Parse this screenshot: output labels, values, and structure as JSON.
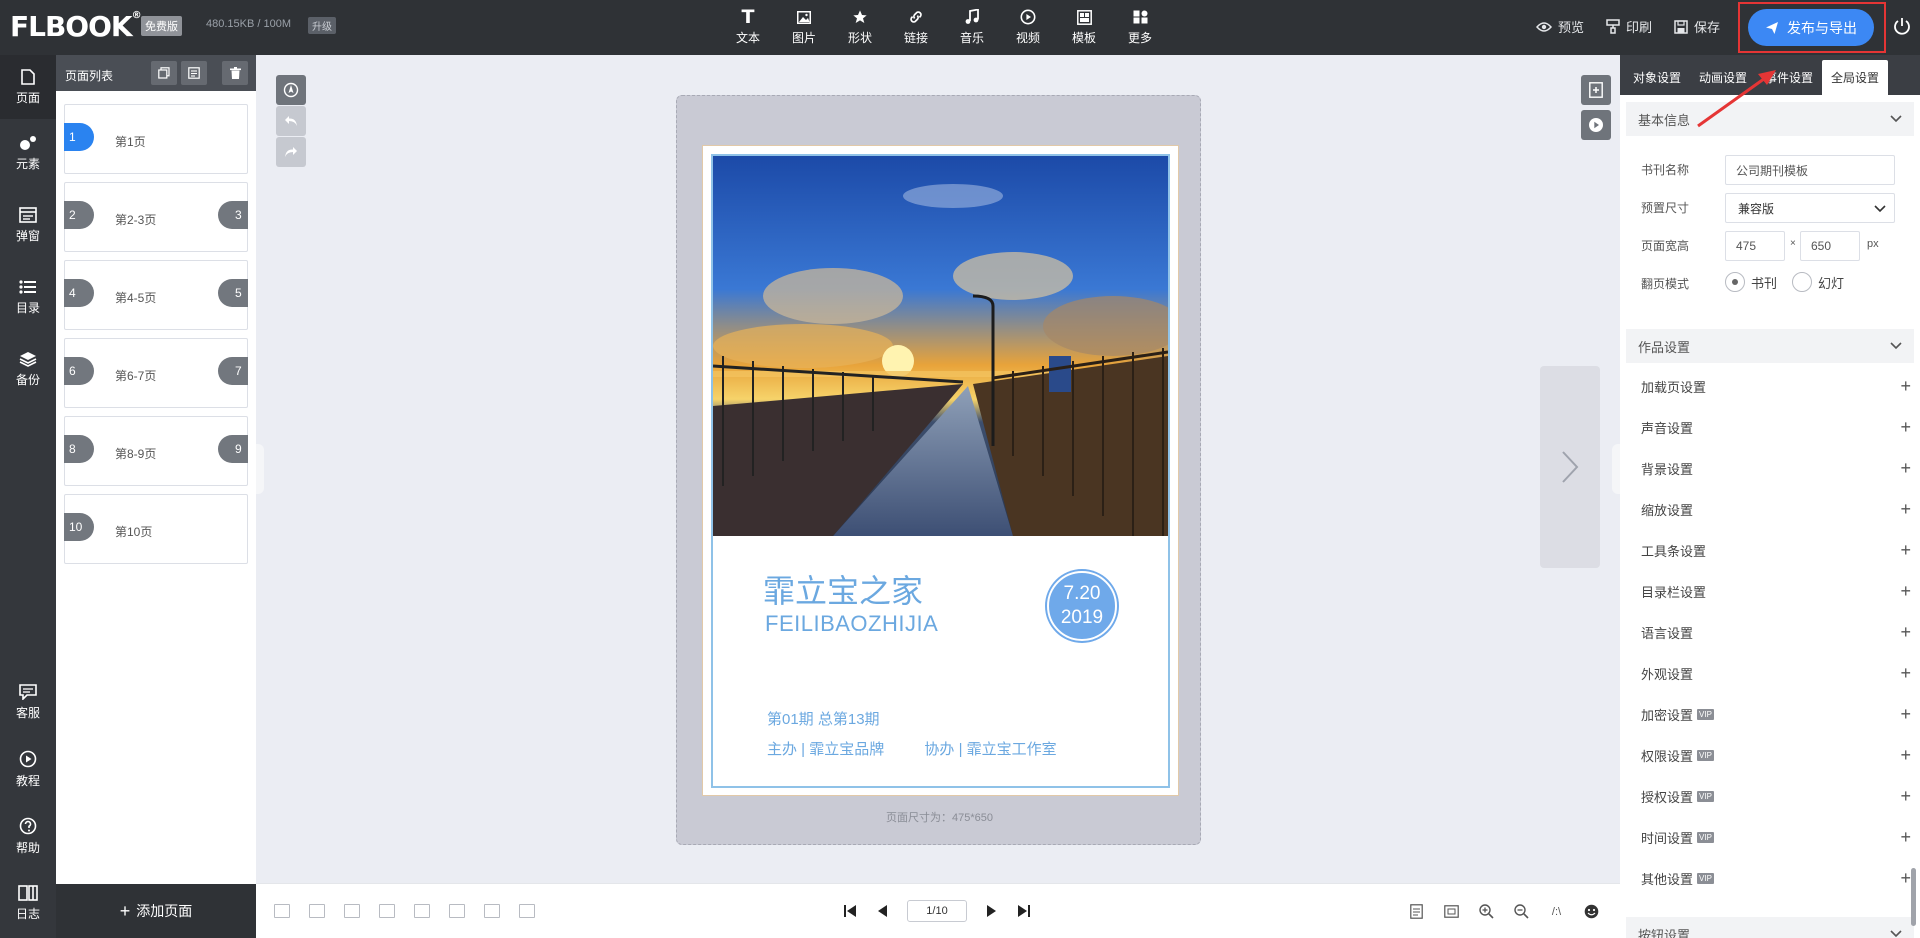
{
  "header": {
    "logo": "FLBOOK",
    "logo_mark": "®",
    "badge_free": "免费版",
    "storage": "480.15KB / 100M",
    "upgrade": "升级",
    "tools": [
      {
        "label": "文本",
        "icon": "text-icon"
      },
      {
        "label": "图片",
        "icon": "image-icon"
      },
      {
        "label": "形状",
        "icon": "star-icon"
      },
      {
        "label": "链接",
        "icon": "link-icon"
      },
      {
        "label": "音乐",
        "icon": "music-icon"
      },
      {
        "label": "视频",
        "icon": "video-icon"
      },
      {
        "label": "模板",
        "icon": "template-icon"
      },
      {
        "label": "更多",
        "icon": "more-icon"
      }
    ],
    "preview": "预览",
    "print": "印刷",
    "save": "保存",
    "publish": "发布与导出",
    "accent": "#3c88f4",
    "annotation_color": "#e53535"
  },
  "leftnav": {
    "items": [
      {
        "label": "页面",
        "icon": "page-icon"
      },
      {
        "label": "元素",
        "icon": "elements-icon"
      },
      {
        "label": "弹窗",
        "icon": "popup-icon"
      },
      {
        "label": "目录",
        "icon": "toc-icon"
      },
      {
        "label": "备份",
        "icon": "backup-icon"
      }
    ],
    "bottom_items": [
      {
        "label": "客服",
        "icon": "chat-icon"
      },
      {
        "label": "教程",
        "icon": "play-icon"
      },
      {
        "label": "帮助",
        "icon": "help-icon"
      },
      {
        "label": "日志",
        "icon": "log-icon"
      }
    ]
  },
  "pagelist": {
    "title": "页面列表",
    "pages": [
      {
        "label": "第1页",
        "left": "1",
        "right": ""
      },
      {
        "label": "第2-3页",
        "left": "2",
        "right": "3"
      },
      {
        "label": "第4-5页",
        "left": "4",
        "right": "5"
      },
      {
        "label": "第6-7页",
        "left": "6",
        "right": "7"
      },
      {
        "label": "第8-9页",
        "left": "8",
        "right": "9"
      },
      {
        "label": "第10页",
        "left": "10",
        "right": ""
      }
    ],
    "add_page": "添加页面"
  },
  "canvas": {
    "cover_title": "霏立宝之家",
    "cover_subtitle": "FEILIBAOZHIJIA",
    "date_line1": "7.20",
    "date_line2": "2019",
    "issue": "第01期 总第13期",
    "host": "主办 | 霏立宝品牌",
    "co_host": "协办 | 霏立宝工作室",
    "size_note": "页面尺寸为：475*650",
    "cover_color": "#6ba8e0"
  },
  "bottombar": {
    "page_indicator": "1/10",
    "ratio_label": "/:\\"
  },
  "rightpanel": {
    "tabs": [
      "对象设置",
      "动画设置",
      "事件设置",
      "全局设置"
    ],
    "basic": {
      "title": "基本信息",
      "book_name_label": "书刊名称",
      "book_name": "公司期刊模板",
      "preset_label": "预置尺寸",
      "preset": "兼容版",
      "size_label": "页面宽高",
      "width": "475",
      "times": "×",
      "height": "650",
      "unit": "px",
      "flip_label": "翻页模式",
      "flip_book": "书刊",
      "flip_slide": "幻灯"
    },
    "work_title": "作品设置",
    "settings": [
      {
        "label": "加载页设置",
        "vip": ""
      },
      {
        "label": "声音设置",
        "vip": ""
      },
      {
        "label": "背景设置",
        "vip": ""
      },
      {
        "label": "缩放设置",
        "vip": ""
      },
      {
        "label": "工具条设置",
        "vip": ""
      },
      {
        "label": "目录栏设置",
        "vip": ""
      },
      {
        "label": "语言设置",
        "vip": ""
      },
      {
        "label": "外观设置",
        "vip": ""
      },
      {
        "label": "加密设置",
        "vip": "VIP"
      },
      {
        "label": "权限设置",
        "vip": "VIP"
      },
      {
        "label": "授权设置",
        "vip": "VIP"
      },
      {
        "label": "时间设置",
        "vip": "VIP"
      },
      {
        "label": "其他设置",
        "vip": "VIP"
      }
    ],
    "button_settings": "按钮设置"
  }
}
